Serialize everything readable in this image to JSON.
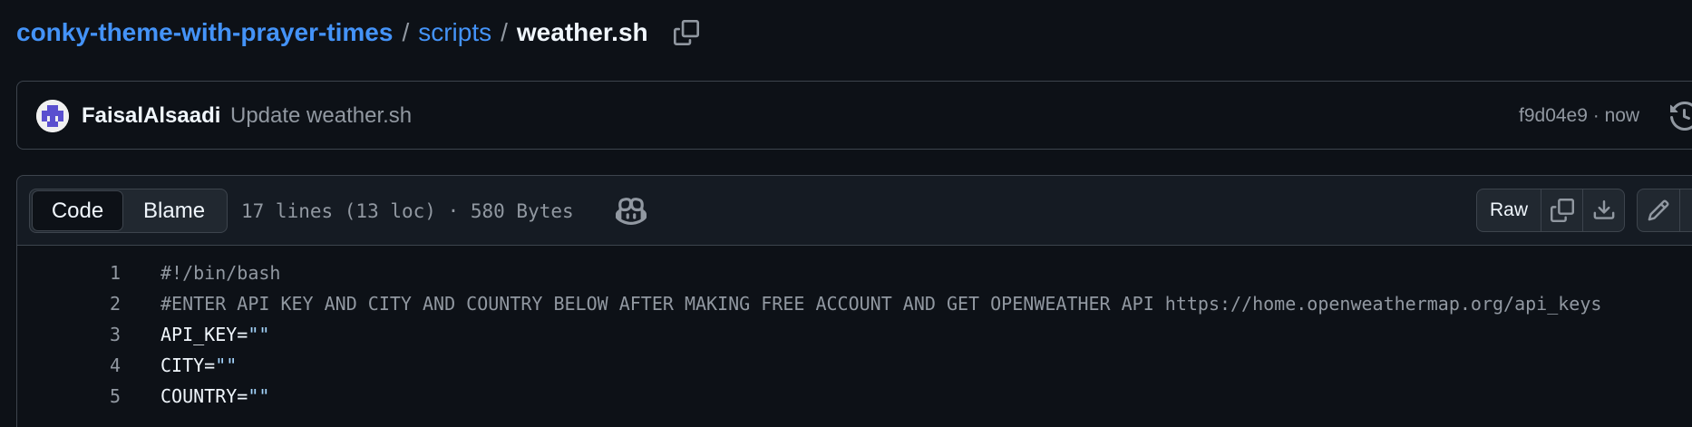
{
  "breadcrumb": {
    "repo": "conky-theme-with-prayer-times",
    "separator1": "/",
    "folder": "scripts",
    "separator2": "/",
    "file": "weather.sh"
  },
  "commit": {
    "author": "FaisalAlsaadi",
    "message": "Update weather.sh",
    "meta": "f9d04e9 · now"
  },
  "file_header": {
    "tab_code": "Code",
    "tab_blame": "Blame",
    "stats": "17 lines (13 loc) · 580 Bytes",
    "raw_label": "Raw"
  },
  "code": {
    "lines": [
      {
        "num": "1",
        "text": "#!/bin/bash"
      },
      {
        "num": "2",
        "text": "#ENTER API KEY AND CITY AND COUNTRY BELOW AFTER MAKING FREE ACCOUNT AND GET OPENWEATHER API https://home.openweathermap.org/api_keys"
      },
      {
        "num": "3",
        "var": "API_KEY=",
        "str": "\"\""
      },
      {
        "num": "4",
        "var": "CITY=",
        "str": "\"\""
      },
      {
        "num": "5",
        "var": "COUNTRY=",
        "str": "\"\""
      }
    ]
  },
  "colors": {
    "background": "#0d1117",
    "link": "#4493f8",
    "muted": "#9198a1",
    "border": "#3d444d",
    "string": "#a5d6ff"
  },
  "icons": [
    "copy-icon",
    "history-icon",
    "copilot-icon",
    "download-icon",
    "pencil-icon"
  ]
}
